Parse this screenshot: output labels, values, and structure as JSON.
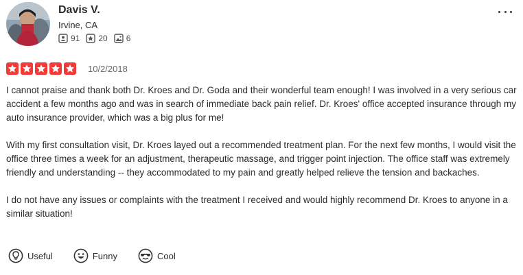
{
  "reviewer": {
    "name": "Davis V.",
    "location": "Irvine, CA",
    "friends_count": "91",
    "reviews_count": "20",
    "photos_count": "6"
  },
  "review": {
    "rating": 5,
    "max_rating": 5,
    "date": "10/2/2018",
    "paragraphs": [
      "I cannot praise and thank both Dr. Kroes and Dr. Goda and their wonderful team enough! I was involved in a very serious car accident a few months ago and was in search of immediate back pain relief. Dr. Kroes' office accepted insurance through my auto insurance provider, which was a big plus for me!",
      "With my first consultation visit, Dr. Kroes layed out a recommended treatment plan. For the next few months, I would visit the office three times a week for an adjustment, therapeutic massage, and trigger point injection. The office staff was extremely friendly and understanding -- they accommodated to my pain and greatly helped relieve the tension and backaches.",
      "I do not have any issues or complaints with the treatment I received and would highly recommend Dr. Kroes to anyone in a similar situation!"
    ]
  },
  "reactions": {
    "useful_label": "Useful",
    "funny_label": "Funny",
    "cool_label": "Cool"
  },
  "icons": {
    "friends": "friends-icon",
    "reviews": "star-review-icon",
    "photos": "photo-icon",
    "more": "more-options-icon",
    "useful": "lightbulb-icon",
    "funny": "smile-icon",
    "cool": "sunglasses-icon"
  },
  "colors": {
    "star_fill": "#f43939",
    "text": "#2b2b2b",
    "muted": "#666666"
  }
}
